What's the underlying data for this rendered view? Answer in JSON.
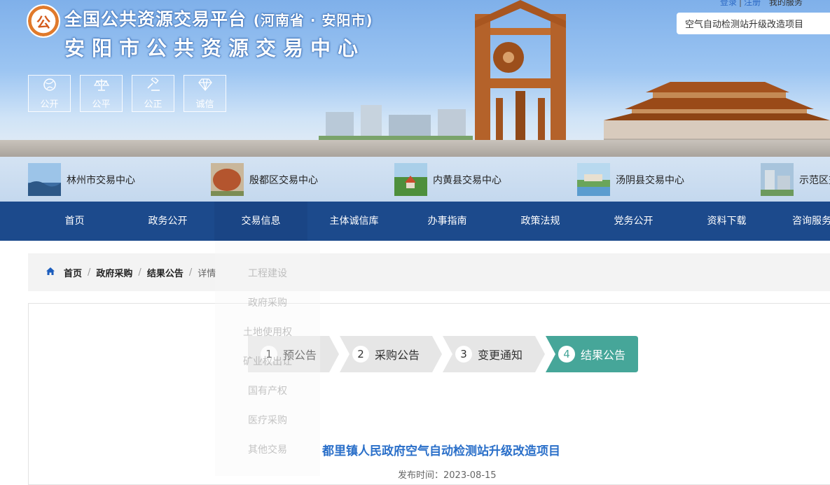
{
  "header": {
    "logo_text": "公",
    "title_main": "全国公共资源交易平台",
    "title_region": "(河南省 · 安阳市)",
    "subtitle": "安阳市公共资源交易中心",
    "badges": [
      {
        "icon": "globe-icon",
        "label": "公开"
      },
      {
        "icon": "scale-icon",
        "label": "公平"
      },
      {
        "icon": "gavel-icon",
        "label": "公正"
      },
      {
        "icon": "diamond-icon",
        "label": "诚信"
      }
    ],
    "login": "登录",
    "register": "注册",
    "my_service": "我的服务",
    "search_value": "空气自动检测站升级改造项目"
  },
  "centers": [
    {
      "name": "林州市交易中心"
    },
    {
      "name": "殷都区交易中心"
    },
    {
      "name": "内黄县交易中心"
    },
    {
      "name": "汤阴县交易中心"
    },
    {
      "name": "示范区交易中心"
    }
  ],
  "nav": {
    "items": [
      "首页",
      "政务公开",
      "交易信息",
      "主体诚信库",
      "办事指南",
      "政策法规",
      "党务公开",
      "资料下载",
      "咨询服务"
    ],
    "active_index": 2
  },
  "dropdown": {
    "items": [
      "工程建设",
      "政府采购",
      "土地使用权",
      "矿业权出让",
      "国有产权",
      "医疗采购",
      "其他交易"
    ]
  },
  "breadcrumb": {
    "home": "首页",
    "level1": "政府采购",
    "level2": "结果公告",
    "current": "详情"
  },
  "steps": [
    {
      "num": "1",
      "label": "预公告"
    },
    {
      "num": "2",
      "label": "采购公告"
    },
    {
      "num": "3",
      "label": "变更通知"
    },
    {
      "num": "4",
      "label": "结果公告"
    }
  ],
  "steps_active_index": 3,
  "colors": {
    "nav_bg": "#1c4a8c",
    "step_active": "#46a699",
    "step_inactive": "#e6e6e6",
    "title_blue": "#2a6fc9"
  },
  "article": {
    "title": "都里镇人民政府空气自动检测站升级改造项目",
    "date_label": "发布时间：",
    "date": "2023-08-15"
  }
}
